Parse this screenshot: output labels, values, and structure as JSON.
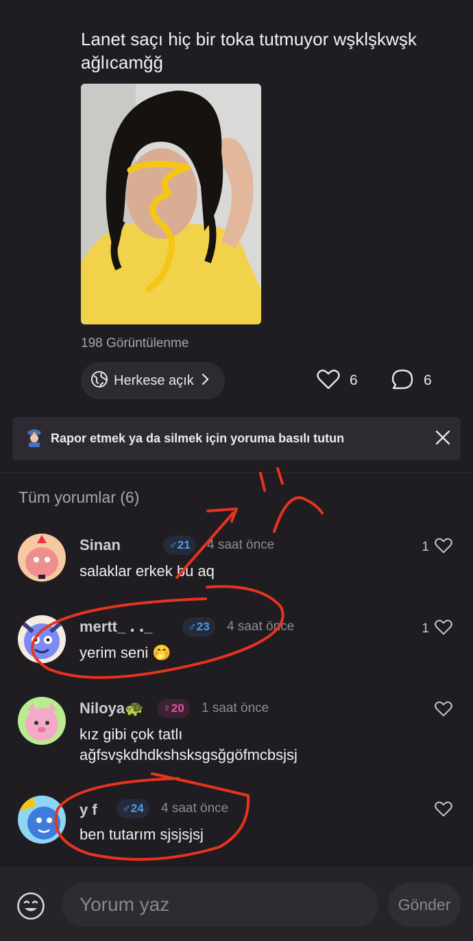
{
  "post": {
    "title": "Lanet saçı hiç bir toka tutmuyor wşklşkwşk ağlıcamğğ",
    "views": "198 Görüntülenme",
    "privacy_label": "Herkese açık",
    "likes": "6",
    "comments_count": "6"
  },
  "banner": {
    "text": "Rapor etmek ya da silmek için yoruma basılı tutun"
  },
  "comments_section": {
    "title": "Tüm yorumlar (6)"
  },
  "comments": [
    {
      "name": "Sinan",
      "badge": "♂21",
      "gender": "male",
      "time": "4 saat önce",
      "text": "salaklar erkek bu   aq",
      "likes": "1"
    },
    {
      "name": "mertt_ ․ ․_",
      "badge": "♂23",
      "gender": "male",
      "time": "4 saat önce",
      "text": "yerim seni 🤭",
      "likes": "1"
    },
    {
      "name": "Niloya🐢",
      "badge": "♀20",
      "gender": "female",
      "time": "1 saat önce",
      "text": " kız gibi çok tatlı\nağfsvşkdhdkshsksgsğgöfmcbsjsj",
      "likes": ""
    },
    {
      "name": "y  f",
      "badge": "♂24",
      "gender": "male",
      "time": "4 saat önce",
      "text": "ben tutarım sjsjsjsj",
      "likes": ""
    }
  ],
  "composer": {
    "placeholder": "Yorum yaz",
    "send_label": "Gönder"
  },
  "colors": {
    "background": "#1f1d22",
    "male_badge": "#4b9cf0",
    "female_badge": "#ee4fa3",
    "annotation": "#e8331e"
  }
}
